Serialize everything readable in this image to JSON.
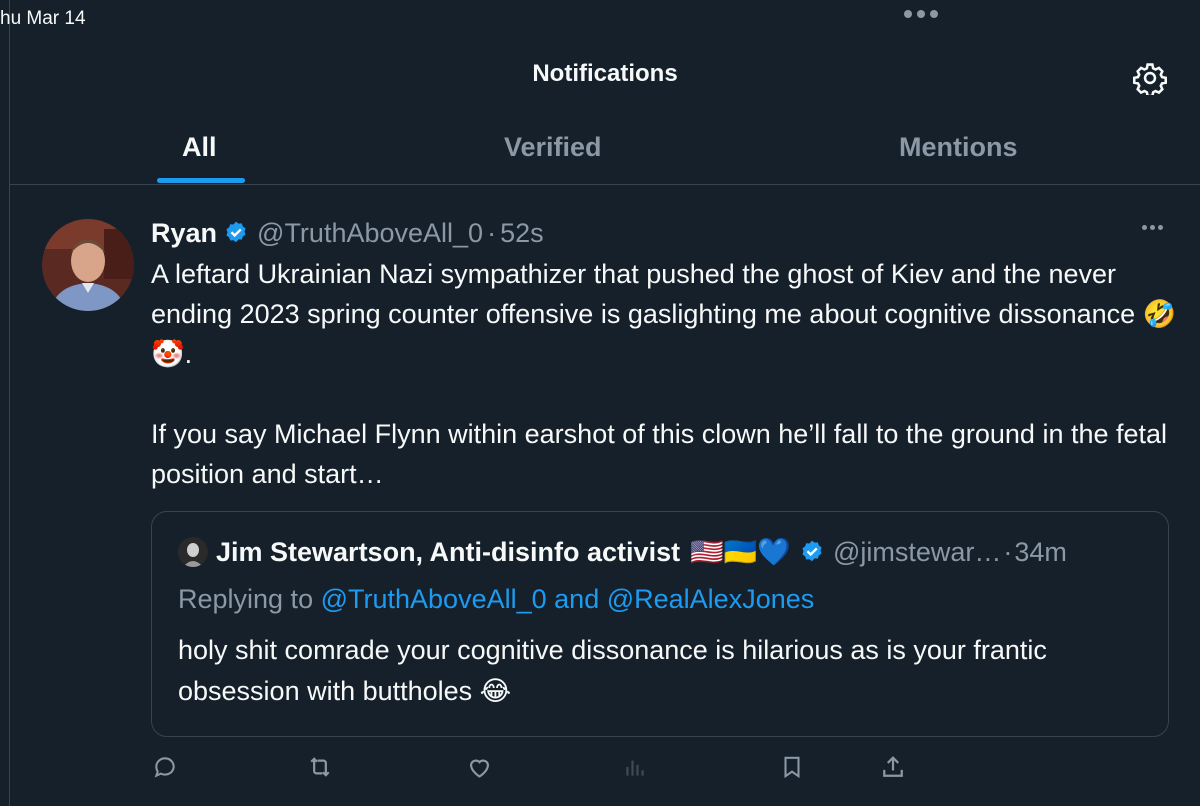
{
  "status_bar": {
    "date": "hu Mar 14"
  },
  "header": {
    "title": "Notifications",
    "settings_icon": "gear-icon"
  },
  "tabs": [
    {
      "label": "All",
      "active": true
    },
    {
      "label": "Verified",
      "active": false
    },
    {
      "label": "Mentions",
      "active": false
    }
  ],
  "tweet": {
    "author_name": "Ryan",
    "verified": true,
    "handle": "@TruthAboveAll_0",
    "separator": "·",
    "time": "52s",
    "text": "A leftard Ukrainian Nazi sympathizer that pushed the ghost of Kiev and the never ending 2023 spring counter offensive is gaslighting me about cognitive dissonance 🤣🤡.\n\nIf you say Michael Flynn within earshot of this clown he’ll fall to the ground in the fetal position and start…",
    "quote": {
      "author_name": "Jim Stewartson, Anti-disinfo activist",
      "name_emojis": "🇺🇸🇺🇦💙",
      "verified": true,
      "handle": "@jimstewar…",
      "separator": "·",
      "time": "34m",
      "replying_to_prefix": "Replying to",
      "replying_to_1": "@TruthAboveAll_0",
      "replying_to_and": "and",
      "replying_to_2": "@RealAlexJones",
      "text": "holy shit comrade your cognitive dissonance is hilarious as is your frantic obsession with buttholes 😂"
    }
  },
  "actions": [
    "reply-icon",
    "retweet-icon",
    "like-icon",
    "views-icon",
    "bookmark-icon",
    "share-icon"
  ],
  "colors": {
    "background": "#15202b",
    "accent": "#1d9bf0",
    "muted": "#8b98a5",
    "border": "#38444d"
  }
}
